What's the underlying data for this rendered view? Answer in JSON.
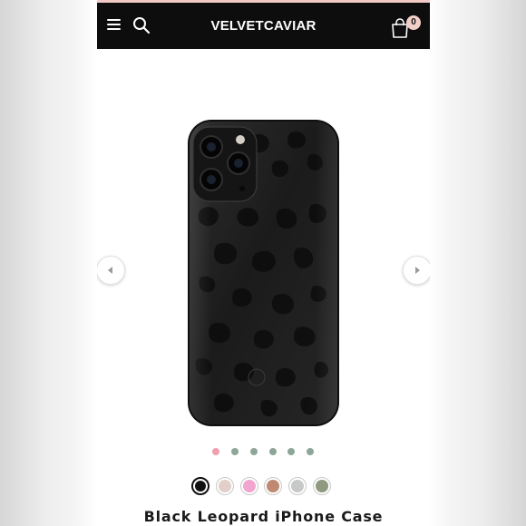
{
  "header": {
    "brand": "VELVETCAVIAR",
    "cart_count": "0",
    "icons": [
      "menu-icon",
      "search-icon",
      "shopping-bag-icon"
    ]
  },
  "product": {
    "title": "Black Leopard iPhone Case",
    "image_alt": "Black leopard print iPhone case"
  },
  "gallery": {
    "dot_count": 6,
    "active_dot_index": 0,
    "prev_icon": "chevron-left-icon",
    "next_icon": "chevron-right-icon"
  },
  "swatches": {
    "selected_index": 0,
    "colors": [
      "#111111",
      "#e2cfc9",
      "#f2a5cf",
      "#c08a72",
      "#c7c8c8",
      "#8f9a80"
    ]
  },
  "colors": {
    "navbar": "#0d0d0d",
    "accent_pink": "#f3cfc9",
    "dot_active": "#ef9fae",
    "dot_inactive": "#8ea69a"
  }
}
